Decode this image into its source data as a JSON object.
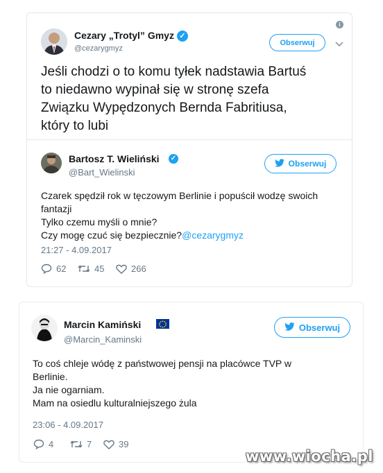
{
  "outer_tweet": {
    "name": "Cezary „Trotyl” Gmyz",
    "handle": "@cezarygmyz",
    "follow_label": "Obserwuj",
    "text": "Jeśli chodzi o to komu tyłek nadstawia Bartuś\nto niedawno wypinał się w stronę szefa\nZwiązku Wypędzonych Bernda Fabritiusa,\nktóry to lubi"
  },
  "quoted_tweet": {
    "name": "Bartosz T. Wieliński",
    "handle": "@Bart_Wielinski",
    "follow_label": "Obserwuj",
    "text_lines": [
      "Czarek spędził rok w tęczowym Berlinie i popuścił wodzę swoich",
      "fantazji",
      "Tylko czemu myśli o mnie?",
      "Czy mogę czuć się bezpiecznie?"
    ],
    "mention": "@cezarygmyz",
    "timestamp": "21:27 - 4.09.2017",
    "replies": "62",
    "retweets": "45",
    "likes": "266"
  },
  "second_tweet": {
    "name": "Marcin Kamiński",
    "handle": "@Marcin_Kaminski",
    "follow_label": "Obserwuj",
    "text": "To coś chleje wódę z państwowej pensji na placówce TVP w\nBerlinie.\nJa nie ogarniam.\nMam na osiedlu kulturalniejszego żula",
    "timestamp": "23:06 - 4.09.2017",
    "replies": "4",
    "retweets": "7",
    "likes": "39"
  },
  "watermark": "www.wiocha.pl",
  "colors": {
    "twitter_blue": "#1da1f2",
    "gray": "#657786",
    "eu_blue": "#003399"
  }
}
